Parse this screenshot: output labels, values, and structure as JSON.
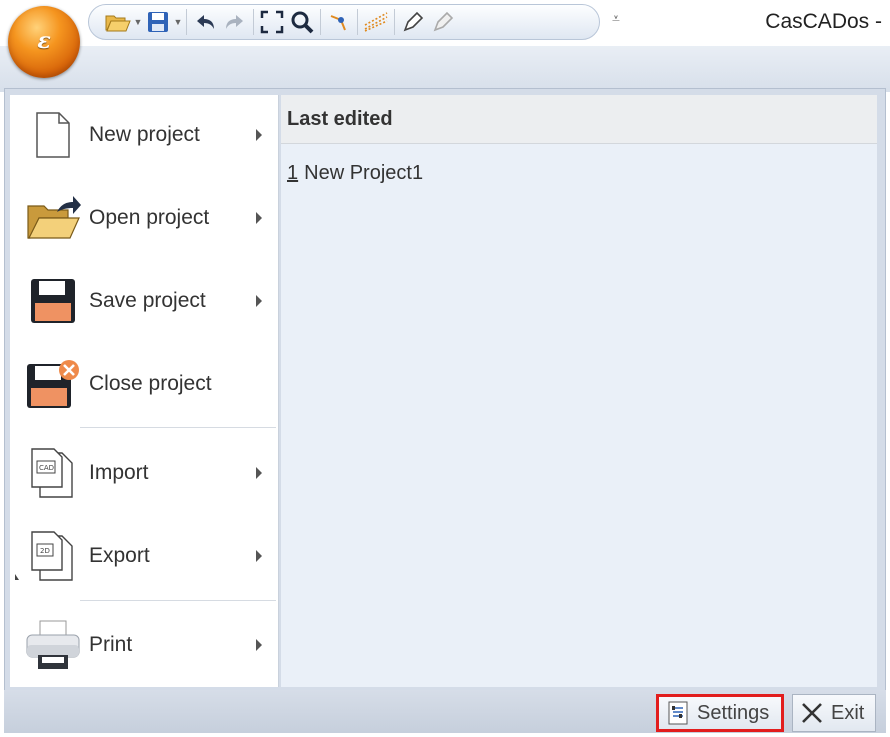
{
  "titlebar": {
    "app_title": "CasCADos -",
    "orb_glyph": "ε",
    "qat_icons": [
      "open-folder-icon",
      "save-disk-icon",
      "undo-icon",
      "redo-icon",
      "zoom-extents-icon",
      "zoom-icon",
      "snap-icon",
      "grid-icon",
      "pen-icon",
      "pen-disabled-icon"
    ]
  },
  "menu": {
    "items": [
      {
        "label": "New project",
        "icon": "new-document-icon",
        "has_submenu": true
      },
      {
        "label": "Open project",
        "icon": "open-folder-icon",
        "has_submenu": true
      },
      {
        "label": "Save project",
        "icon": "save-disk-icon",
        "has_submenu": true
      },
      {
        "label": "Close project",
        "icon": "close-disk-icon",
        "has_submenu": false
      },
      {
        "label": "Import",
        "icon": "import-cad-icon",
        "has_submenu": true
      },
      {
        "label": "Export",
        "icon": "export-2d-icon",
        "has_submenu": true
      },
      {
        "label": "Print",
        "icon": "printer-icon",
        "has_submenu": true
      }
    ]
  },
  "recent": {
    "header": "Last edited",
    "items": [
      {
        "num": "1",
        "name": "New Project1"
      }
    ]
  },
  "footer": {
    "settings_label": "Settings",
    "exit_label": "Exit",
    "highlight_color": "#e21d1d"
  },
  "colors": {
    "orb": "#f5951f",
    "menu_bg": "#d4dce8",
    "recent_bg": "#eaf0f8"
  }
}
